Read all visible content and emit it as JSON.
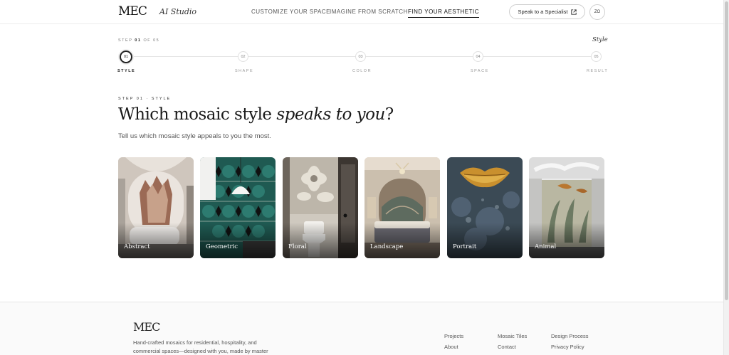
{
  "header": {
    "logo": "MEC",
    "logo_sub": "AI Studio",
    "nav": [
      "CUSTOMIZE YOUR SPACE",
      "IMAGINE FROM SCRATCH",
      "FIND YOUR AESTHETIC"
    ],
    "active_nav": "FIND YOUR AESTHETIC",
    "specialist_button": "Speak to a Specialist",
    "specialist_icon": "external-link-icon",
    "avatar_initials": "ZO"
  },
  "stepper": {
    "step_prefix": "STEP",
    "current_step": "01",
    "of_text": "OF",
    "total_steps": "05",
    "current_title": "Style",
    "steps": [
      {
        "number": "01",
        "label": "STYLE",
        "active": true
      },
      {
        "number": "02",
        "label": "SHAPE",
        "active": false
      },
      {
        "number": "03",
        "label": "COLOR",
        "active": false
      },
      {
        "number": "04",
        "label": "SPACE",
        "active": false
      },
      {
        "number": "05",
        "label": "RESULT",
        "active": false
      }
    ]
  },
  "main": {
    "eyebrow": "STEP 01 · STYLE",
    "headline_start": "Which mosaic style ",
    "headline_emphasis": "speaks to you",
    "headline_end": "?",
    "subline": "Tell us which mosaic style appeals to you the most.",
    "styles": [
      "Abstract",
      "Geometric",
      "Floral",
      "Landscape",
      "Portrait",
      "Animal"
    ]
  },
  "footer": {
    "logo": "MEC",
    "description": "Hand-crafted mosaics for residential, hospitality, and commercial spaces—designed with you, made by master",
    "links": [
      "Projects",
      "Mosaic Tiles",
      "Design Process",
      "About",
      "Contact",
      "Privacy Policy"
    ]
  },
  "colors": {
    "text": "#222222",
    "muted": "#777777",
    "border": "#e4e4e4",
    "footer_bg": "#fafafa"
  }
}
